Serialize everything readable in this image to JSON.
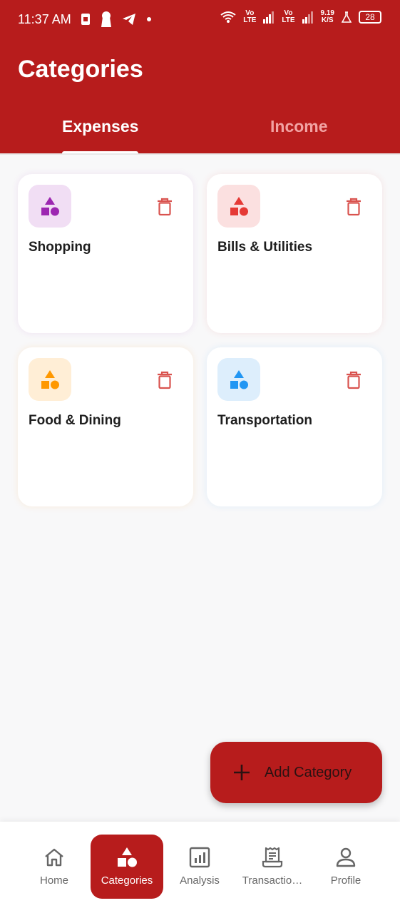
{
  "status_bar": {
    "time": "11:37 AM",
    "net1": "Vo",
    "net1b": "LTE",
    "net2": "Vo",
    "net2b": "LTE",
    "speed_value": "9.19",
    "speed_unit": "K/S",
    "battery": "28"
  },
  "header": {
    "title": "Categories",
    "color": "#b71c1c"
  },
  "tabs": [
    {
      "label": "Expenses",
      "active": true
    },
    {
      "label": "Income",
      "active": false
    }
  ],
  "categories": [
    {
      "name": "Shopping",
      "icon": "category-shapes-icon",
      "color": "#9c27b0",
      "bg": "#f1def4"
    },
    {
      "name": "Bills & Utilities",
      "icon": "category-shapes-icon",
      "color": "#e53935",
      "bg": "#fbe0e0"
    },
    {
      "name": "Food & Dining",
      "icon": "category-shapes-icon",
      "color": "#ff9800",
      "bg": "#ffeed6"
    },
    {
      "name": "Transportation",
      "icon": "category-shapes-icon",
      "color": "#2196f3",
      "bg": "#ddeefc"
    }
  ],
  "fab": {
    "label": "Add Category",
    "icon": "plus-icon"
  },
  "bottom_nav": [
    {
      "label": "Home",
      "icon": "home-icon",
      "active": false
    },
    {
      "label": "Categories",
      "icon": "category-shapes-icon",
      "active": true
    },
    {
      "label": "Analysis",
      "icon": "analytics-icon",
      "active": false
    },
    {
      "label": "Transactio…",
      "icon": "receipt-icon",
      "active": false
    },
    {
      "label": "Profile",
      "icon": "person-icon",
      "active": false
    }
  ]
}
